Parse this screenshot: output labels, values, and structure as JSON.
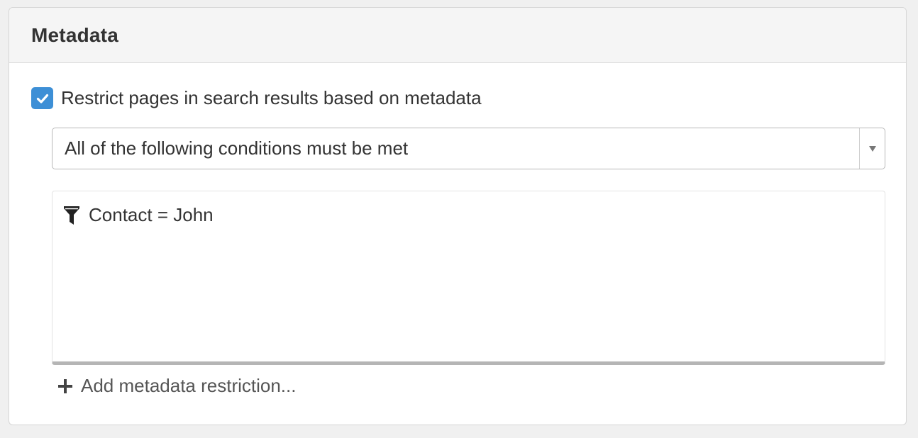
{
  "panel": {
    "title": "Metadata"
  },
  "restrict_option": {
    "checked": true,
    "label": "Restrict pages in search results based on metadata",
    "icon": "checkmark-icon"
  },
  "condition_select": {
    "value": "All of the following conditions must be met",
    "icon": "caret-down-icon"
  },
  "restrictions": {
    "items": [
      {
        "label": "Contact = John",
        "icon": "filter-icon"
      }
    ]
  },
  "add_restriction": {
    "label": "Add metadata restriction...",
    "icon": "plus-icon"
  },
  "colors": {
    "accent": "#3d8fd6",
    "header_bg": "#f5f5f5",
    "text": "#333333"
  }
}
